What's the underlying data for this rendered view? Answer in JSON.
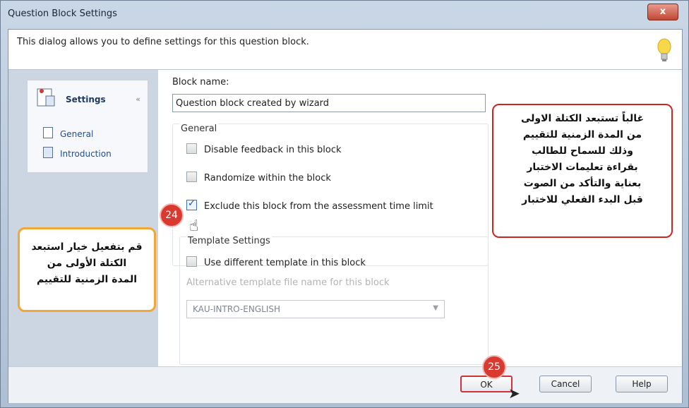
{
  "window": {
    "title": "Question Block Settings",
    "close_label": "x"
  },
  "header": {
    "description": "This dialog allows you to define settings for this question block."
  },
  "nav": {
    "section_label": "Settings",
    "collapse_glyph": "«",
    "items": [
      {
        "label": "General"
      },
      {
        "label": "Introduction"
      }
    ]
  },
  "form": {
    "block_name_label": "Block name:",
    "block_name_value": "Question block created by wizard",
    "general_group_title": "General",
    "checkboxes": [
      {
        "label": "Disable feedback in this block",
        "checked": false
      },
      {
        "label": "Randomize within the block",
        "checked": false
      },
      {
        "label": "Exclude this block from the assessment time limit",
        "checked": true
      }
    ],
    "template_group_title": "Template Settings",
    "use_template_label": "Use different template in this block",
    "alt_template_label": "Alternative template file name for this block",
    "template_select_value": "KAU-INTRO-ENGLISH"
  },
  "footer": {
    "ok_label": "OK",
    "cancel_label": "Cancel",
    "help_label": "Help"
  },
  "annotations": {
    "step_24": "24",
    "step_25": "25",
    "callout_red": "غالباً تستبعد الكتلة الاولى\nمن المدة الزمنية للتقييم\nوذلك للسماح للطالب\nبقراءة تعليمات الاختبار\nبعناية والتأكد من الصوت\nقبل البدء الفعلي للاختبار",
    "callout_orange": "قم بتفعيل خيار استبعد\nالكتلة  الأولى من\nالمدة الزمنية للتقييم"
  },
  "colors": {
    "accent_red": "#d9392f",
    "callout_orange": "#f1a636",
    "nav_text": "#1d4e96"
  }
}
